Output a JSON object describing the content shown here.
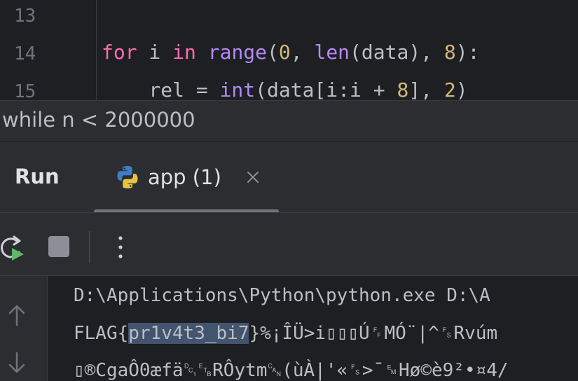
{
  "editor": {
    "line_numbers": [
      "13",
      "14",
      "15"
    ],
    "line14": {
      "kw_for": "for",
      "var_i": " i ",
      "kw_in": "in",
      "sp": " ",
      "fn_range": "range",
      "p1": "(",
      "n0": "0",
      "p2": ", ",
      "fn_len": "len",
      "p3": "(data), ",
      "n8": "8",
      "p4": "):"
    },
    "line15": {
      "indent": "    rel = ",
      "fn_int": "int",
      "p1": "(data[i:i + ",
      "n8": "8",
      "p2": "], ",
      "n2": "2",
      "p3": ")"
    }
  },
  "sticky_hint": "while n < 2000000",
  "run_panel": {
    "title": "Run",
    "tab_label": "app (1)"
  },
  "console": {
    "line1": "D:\\Applications\\Python\\python.exe D:\\A",
    "line2_prefix": "FLAG{",
    "line2_selected": "pr1v4t3_bi7",
    "line2_suffix": "}%¡ÎÜ>i▯▯▯Ú␌MÓ¨|^␜Rvúm",
    "line3": "▯®CgaÔ0æfä␑␗RÔytm␘(ùÀ|'«␜>¯␙Hø©è9²•¤4/"
  },
  "colors": {
    "background": "#1e1f22",
    "panel": "#2b2d30",
    "keyword": "#ff6ab3",
    "function": "#b389f5",
    "number": "#d5b778",
    "selection": "#43546e"
  }
}
